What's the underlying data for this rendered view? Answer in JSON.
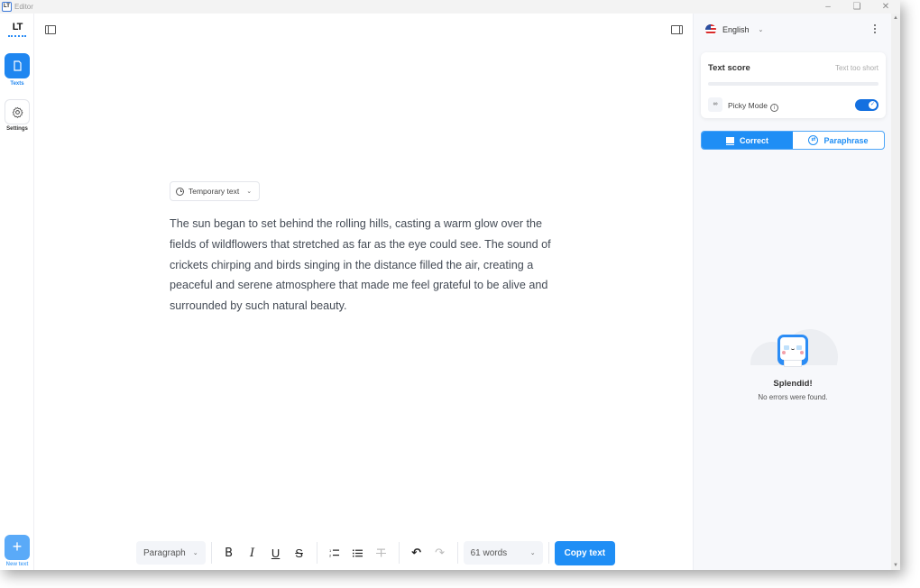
{
  "window": {
    "title": "Editor",
    "app_icon": "LT",
    "controls": {
      "minimize": "–",
      "maximize": "❏",
      "close": "✕"
    }
  },
  "sidebar": {
    "logo": "LT",
    "items": [
      {
        "label": "Texts",
        "icon": "document-icon",
        "active": true
      },
      {
        "label": "Settings",
        "icon": "gear-icon",
        "active": false
      }
    ],
    "new_text": {
      "label": "New text",
      "icon": "plus-icon",
      "glyph": "+"
    }
  },
  "editor": {
    "temporary_label": "Temporary text",
    "body": "The sun began to set behind the rolling hills, casting a warm glow over the fields of wildflowers that stretched as far as the eye could see. The sound of crickets chirping and birds singing in the distance filled the air, creating a peaceful and serene atmosphere that made me feel grateful to be alive and surrounded by such natural beauty."
  },
  "toolbar": {
    "paragraph_label": "Paragraph",
    "bold": "B",
    "italic": "I",
    "underline": "U",
    "strike": "S",
    "ordered_list": "①",
    "bullet_list": "☰",
    "clear_format": "T",
    "undo": "↶",
    "redo": "↷",
    "word_count": "61 words",
    "copy_label": "Copy text"
  },
  "panel": {
    "language": "English",
    "score": {
      "title": "Text score",
      "status": "Text too short",
      "value": 0
    },
    "picky_mode": {
      "label": "Picky Mode",
      "icon": "glasses-icon",
      "info": "i",
      "enabled": true,
      "check": "✓"
    },
    "modes": [
      {
        "label": "Correct",
        "active": true
      },
      {
        "label": "Paraphrase",
        "active": false
      }
    ],
    "empty_state": {
      "title": "Splendid!",
      "subtitle": "No errors were found."
    }
  },
  "colors": {
    "accent": "#1f86f0",
    "accent_light": "#5aaaf8",
    "panel_bg": "#f7f8fb"
  }
}
